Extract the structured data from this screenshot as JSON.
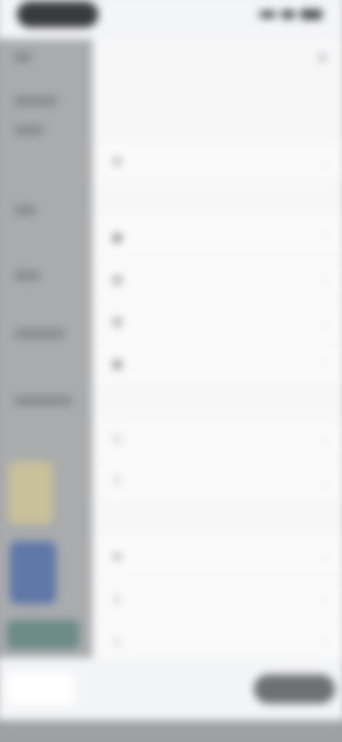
{
  "status_bar": {
    "pill_label": "",
    "icons": [
      "signal-icon",
      "wifi-icon",
      "battery-icon"
    ]
  },
  "drawer": {
    "title": "",
    "close_icon": "close-icon",
    "subtitle": "",
    "sections": [
      {
        "label": "",
        "rows": [
          {
            "icon": "gear-icon",
            "glyph": "⚙",
            "label": ""
          }
        ]
      },
      {
        "label": "",
        "rows": [
          {
            "icon": "image-icon",
            "glyph": "▣",
            "label": ""
          },
          {
            "icon": "file-icon",
            "glyph": "▤",
            "label": ""
          },
          {
            "icon": "document-icon",
            "glyph": "▥",
            "label": ""
          },
          {
            "icon": "folder-icon",
            "glyph": "▦",
            "label": ""
          }
        ]
      },
      {
        "label": "",
        "rows": [
          {
            "icon": "info-icon",
            "glyph": "ⓘ",
            "label": ""
          },
          {
            "icon": "help-icon",
            "glyph": "?",
            "label": ""
          }
        ]
      },
      {
        "label": "",
        "rows": [
          {
            "icon": "mail-icon",
            "glyph": "✉",
            "label": ""
          },
          {
            "icon": "share-icon",
            "glyph": "⇪",
            "label": ""
          },
          {
            "icon": "star-icon",
            "glyph": "☆",
            "label": ""
          }
        ]
      }
    ]
  },
  "bottom_sheet": {
    "text": "",
    "button_label": ""
  },
  "colors": {
    "accent": "#36a7b6",
    "drawer_bg": "#f7f7f8",
    "overlay_dim": "#9b9d9f",
    "button_bg": "#6e7073"
  }
}
